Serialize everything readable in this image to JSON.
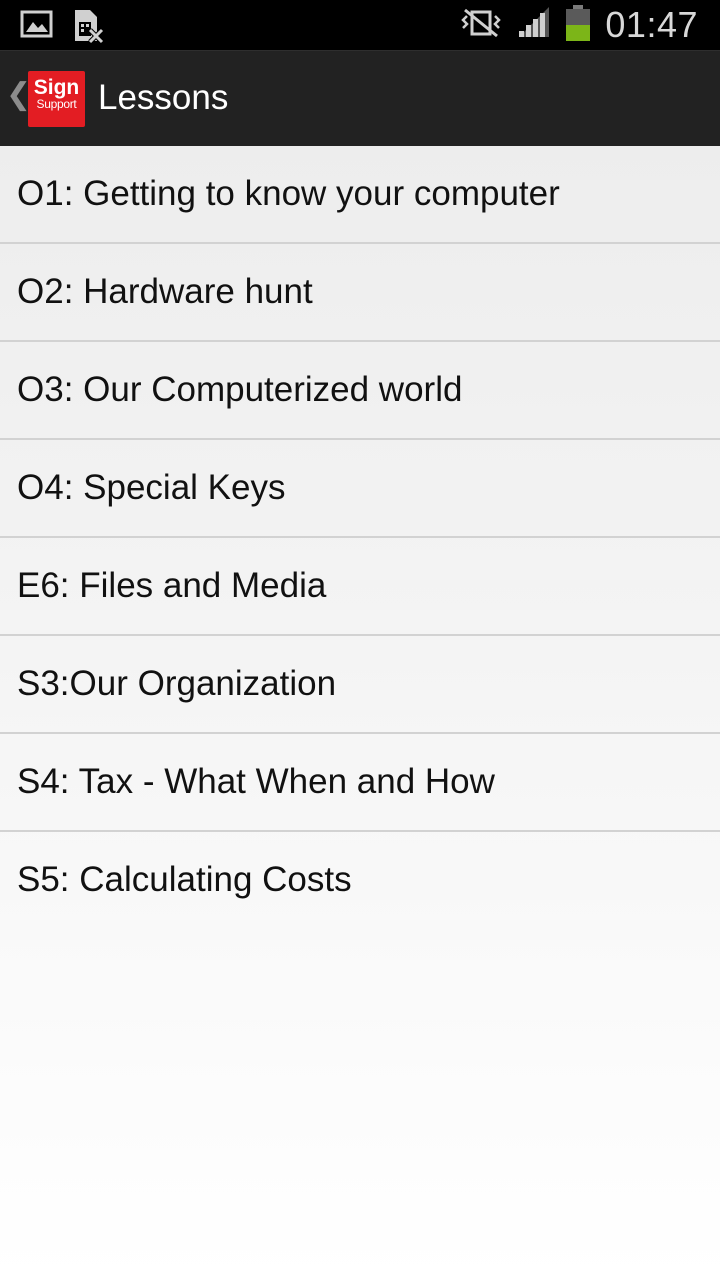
{
  "status_bar": {
    "time": "01:47",
    "left_icons": [
      "image-notification-icon",
      "sim-error-icon"
    ],
    "right_icons": [
      "vibrate-mute-icon",
      "signal-icon",
      "battery-icon"
    ],
    "battery_color": "#7cb518"
  },
  "action_bar": {
    "logo_line1": "Sign",
    "logo_line2": "Support",
    "title": "Lessons",
    "logo_color": "#e31d23"
  },
  "lessons": [
    {
      "label": "O1: Getting to know your computer"
    },
    {
      "label": "O2: Hardware hunt"
    },
    {
      "label": "O3: Our Computerized world"
    },
    {
      "label": "O4: Special Keys"
    },
    {
      "label": "E6: Files and Media"
    },
    {
      "label": "S3:Our Organization"
    },
    {
      "label": "S4: Tax - What When and How"
    },
    {
      "label": "S5: Calculating Costs"
    }
  ]
}
